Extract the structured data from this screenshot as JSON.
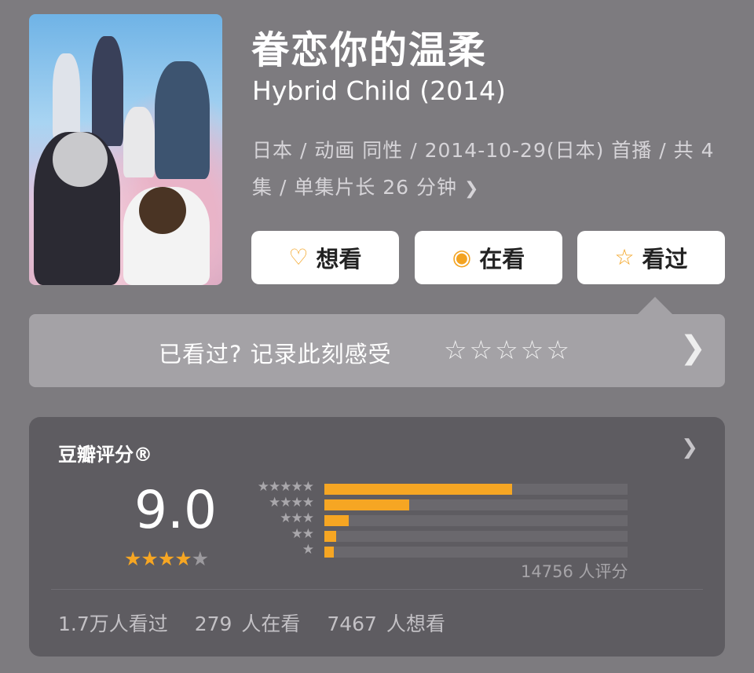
{
  "movie": {
    "title": "眷恋你的温柔",
    "original_title": "Hybrid Child (2014)",
    "meta_line1": "日本 / 动画 同性 / 2014-10-29(日本) 首播 / 共 4",
    "meta_line2": "集 / 单集片长 26 分钟",
    "meta_more_icon": "chevron-right-icon"
  },
  "actions": {
    "want_label": "想看",
    "watching_label": "在看",
    "watched_label": "看过",
    "want_icon": "heart-plus-icon",
    "watching_icon": "target-icon",
    "watched_icon": "star-outline-icon"
  },
  "record": {
    "prompt": "已看过? 记录此刻感受",
    "stars_glyph": "☆☆☆☆☆"
  },
  "rating": {
    "label": "豆瓣评分®",
    "score": "9.0",
    "stars_full": "★★★★",
    "stars_half": "★",
    "star_value": 4.5,
    "distribution": [
      {
        "stars": "★★★★★",
        "percent": 62
      },
      {
        "stars": "★★★★",
        "percent": 28
      },
      {
        "stars": "★★★",
        "percent": 8
      },
      {
        "stars": "★★",
        "percent": 4
      },
      {
        "stars": "★",
        "percent": 3
      }
    ],
    "raters": "14756 人评分",
    "watched": "1.7万人看过",
    "watching": "279 人在看",
    "wanting": "7467 人想看",
    "accent_color": "#f6a623"
  }
}
